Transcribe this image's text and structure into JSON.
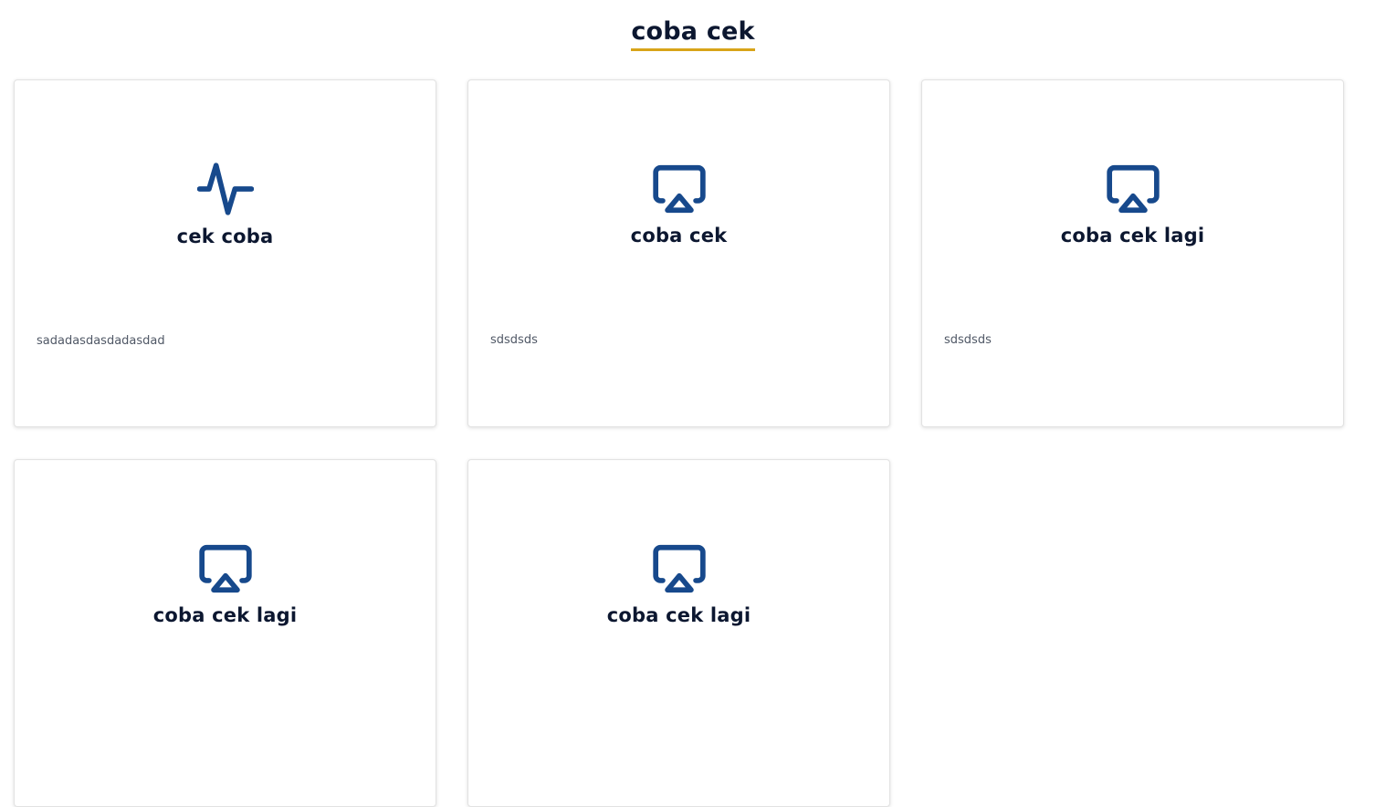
{
  "page": {
    "title": "coba cek"
  },
  "colors": {
    "icon": "#17498c",
    "title_underline": "#d8a419",
    "heading_text": "#0c1730",
    "desc_text": "#505866"
  },
  "cards": [
    {
      "icon": "activity-icon",
      "title": "cek coba",
      "description": "sadadasdasdadasdad"
    },
    {
      "icon": "airplay-icon",
      "title": "coba cek",
      "description": "sdsdsds"
    },
    {
      "icon": "airplay-icon",
      "title": "coba cek lagi",
      "description": "sdsdsds"
    },
    {
      "icon": "airplay-icon",
      "title": "coba cek lagi",
      "description": ""
    },
    {
      "icon": "airplay-icon",
      "title": "coba cek lagi",
      "description": ""
    }
  ]
}
